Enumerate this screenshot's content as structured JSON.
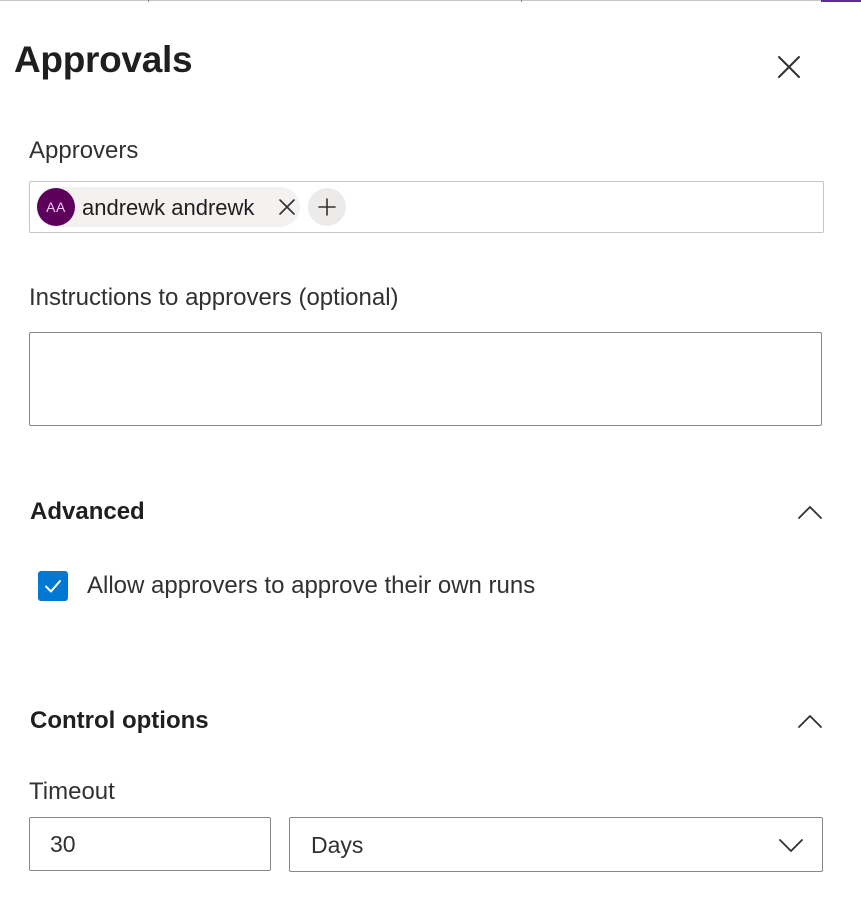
{
  "panel": {
    "title": "Approvals",
    "close_icon": "close-icon"
  },
  "approvers": {
    "label": "Approvers",
    "selected": [
      {
        "initials": "AA",
        "name": "andrewk andrewk",
        "avatar_color": "#5c005c"
      }
    ],
    "add_icon": "plus-icon",
    "remove_icon": "close-icon"
  },
  "instructions": {
    "label": "Instructions to approvers (optional)",
    "value": "",
    "placeholder": ""
  },
  "advanced": {
    "title": "Advanced",
    "expanded": true,
    "chevron_icon": "chevron-up-icon",
    "allow_self_approve": {
      "label": "Allow approvers to approve their own runs",
      "checked": true
    }
  },
  "control_options": {
    "title": "Control options",
    "expanded": true,
    "chevron_icon": "chevron-up-icon",
    "timeout": {
      "label": "Timeout",
      "value": "30",
      "unit": "Days",
      "unit_icon": "chevron-down-icon"
    }
  },
  "colors": {
    "accent": "#0078d4",
    "avatar": "#5c005c",
    "text": "#201f1e",
    "border": "#8a8886"
  }
}
